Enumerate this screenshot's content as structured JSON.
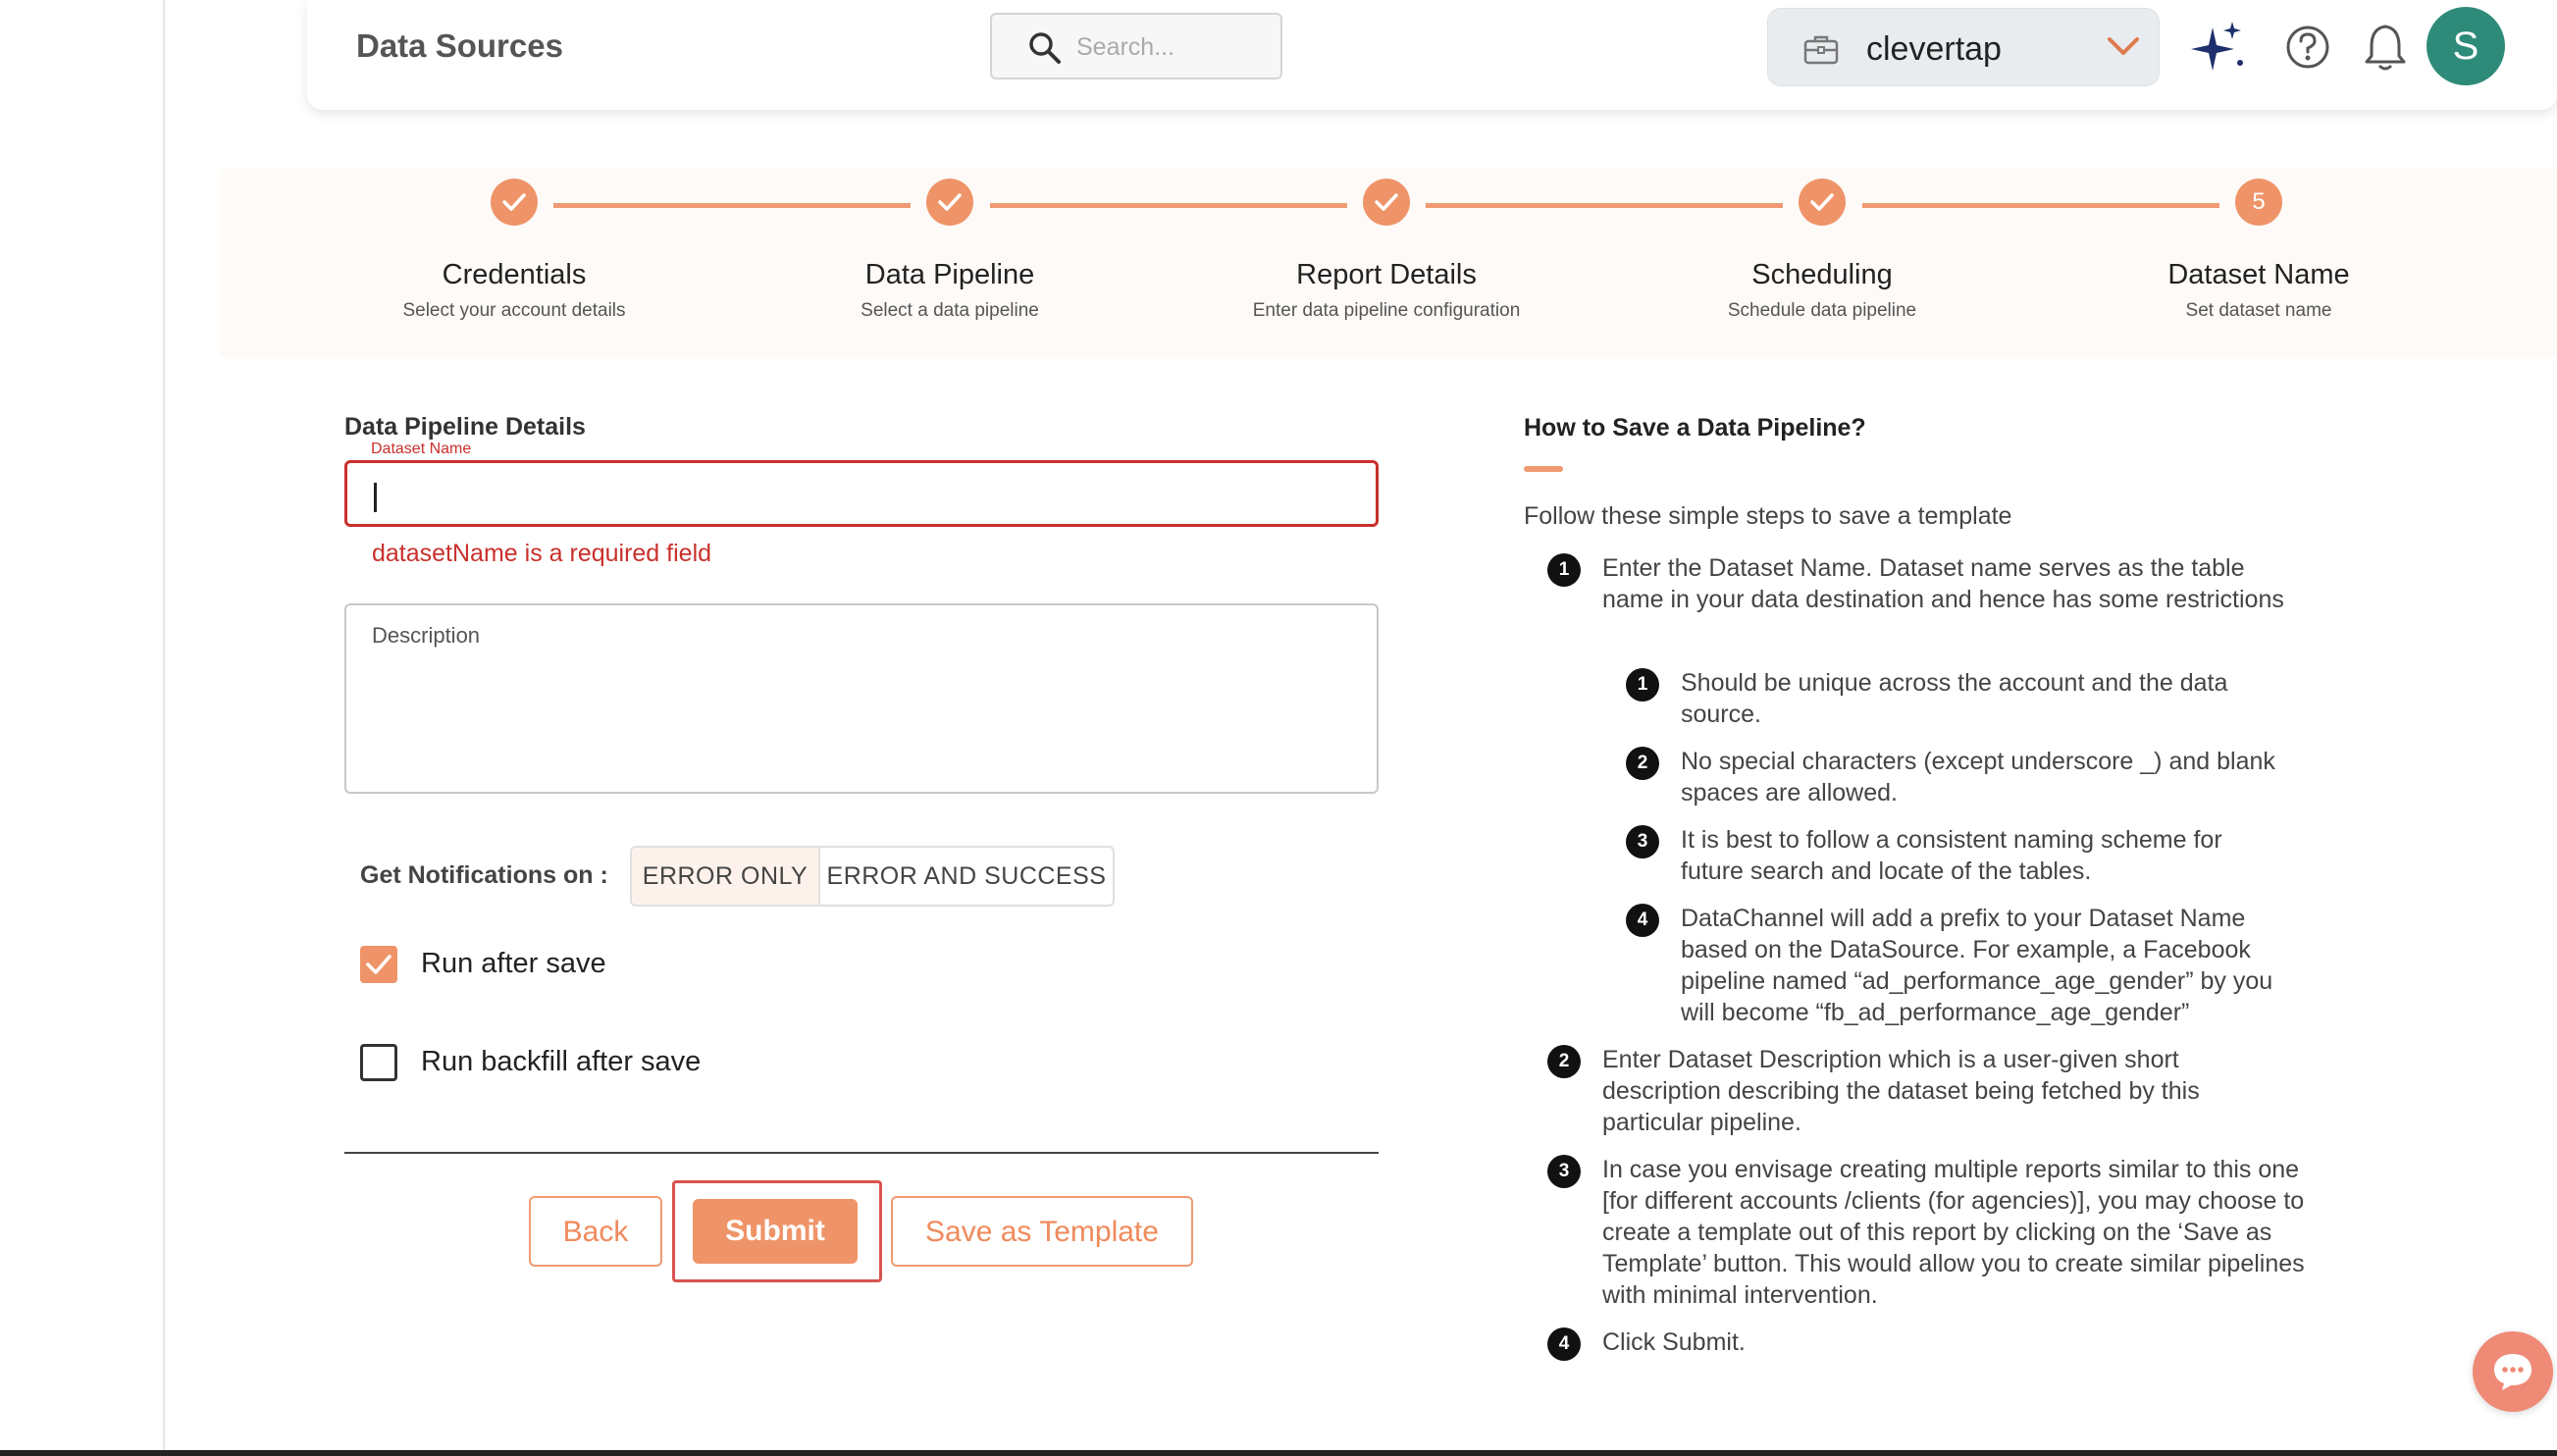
{
  "header": {
    "title": "Data Sources",
    "search_placeholder": "Search...",
    "account_name": "clevertap",
    "avatar_letter": "S"
  },
  "stepper": {
    "steps": [
      {
        "label": "Credentials",
        "sub": "Select your account details",
        "state": "done"
      },
      {
        "label": "Data Pipeline",
        "sub": "Select a data pipeline",
        "state": "done"
      },
      {
        "label": "Report Details",
        "sub": "Enter data pipeline configuration",
        "state": "done"
      },
      {
        "label": "Scheduling",
        "sub": "Schedule data pipeline",
        "state": "done"
      },
      {
        "label": "Dataset Name",
        "sub": "Set dataset name",
        "state": "current",
        "number": "5"
      }
    ]
  },
  "form": {
    "title": "Data Pipeline Details",
    "dataset_label": "Dataset Name",
    "dataset_value": "",
    "dataset_error": "datasetName is a required field",
    "description_label": "Description",
    "description_value": "",
    "notifications_label": "Get Notifications on :",
    "notify_options": [
      "ERROR ONLY",
      "ERROR AND SUCCESS"
    ],
    "notify_selected": "ERROR ONLY",
    "run_after_save_label": "Run after save",
    "run_after_save_checked": true,
    "run_backfill_label": "Run backfill after save",
    "run_backfill_checked": false,
    "back_label": "Back",
    "submit_label": "Submit",
    "template_label": "Save as Template"
  },
  "help": {
    "title": "How to Save a Data Pipeline?",
    "intro": "Follow these simple steps to save a template",
    "items": [
      {
        "num": "1",
        "text": "Enter the Dataset Name. Dataset name serves as the table name in your data destination and hence has some restrictions"
      },
      {
        "num": "2",
        "text": "Enter Dataset Description which is a user-given short description describing the dataset being fetched by this particular pipeline."
      },
      {
        "num": "3",
        "text": "In case you envisage creating multiple reports similar to this one [for different accounts /clients (for agencies)], you may choose to create a template out of this report by clicking on the ‘Save as Template’ button. This would allow you to create similar pipelines with minimal intervention."
      },
      {
        "num": "4",
        "text": "Click Submit."
      }
    ],
    "subitems": [
      {
        "num": "1",
        "text": "Should be unique across the account and the data source."
      },
      {
        "num": "2",
        "text": "No special characters (except underscore _) and blank spaces are allowed."
      },
      {
        "num": "3",
        "text": "It is best to follow a consistent naming scheme for future search and locate of the tables."
      },
      {
        "num": "4",
        "text": "DataChannel will add a prefix to your Dataset Name based on the DataSource. For example, a Facebook pipeline named “ad_performance_age_gender” by you will become “fb_ad_performance_age_gender”"
      }
    ]
  },
  "colors": {
    "accent": "#ef9468",
    "error": "#c9302c",
    "avatar": "#2e8b7a"
  }
}
